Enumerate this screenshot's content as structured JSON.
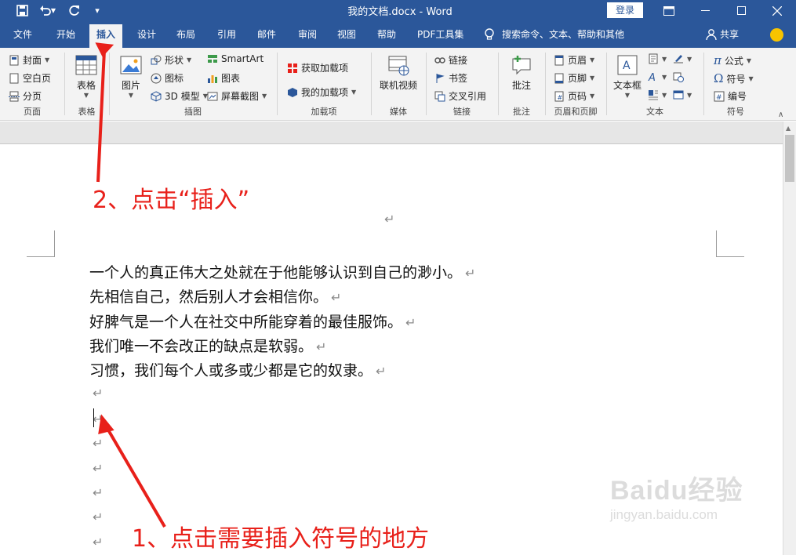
{
  "titlebar": {
    "title": "我的文档.docx - Word",
    "login": "登录"
  },
  "tabs": [
    "文件",
    "开始",
    "插入",
    "设计",
    "布局",
    "引用",
    "邮件",
    "审阅",
    "视图",
    "帮助",
    "PDF工具集"
  ],
  "search_text": "搜索命令、文本、帮助和其他",
  "share_label": "共享",
  "ribbon": {
    "pages": {
      "cover": "封面",
      "blank": "空白页",
      "break": "分页",
      "label": "页面"
    },
    "table": {
      "btn": "表格",
      "label": "表格"
    },
    "illus": {
      "picture": "图片",
      "shape": "形状",
      "icon": "图标",
      "model": "3D 模型",
      "smartart": "SmartArt",
      "chart": "图表",
      "screenshot": "屏幕截图",
      "label": "插图"
    },
    "addins": {
      "get": "获取加载项",
      "my": "我的加载项",
      "label": "加载项"
    },
    "media": {
      "video": "联机视频",
      "label": "媒体"
    },
    "links": {
      "link": "链接",
      "bookmark": "书签",
      "xref": "交叉引用",
      "label": "链接"
    },
    "comments": {
      "comment": "批注",
      "label": "批注"
    },
    "hf": {
      "header": "页眉",
      "footer": "页脚",
      "pagenum": "页码",
      "label": "页眉和页脚"
    },
    "text": {
      "textbox": "文本框",
      "label": "文本"
    },
    "symbols": {
      "equation": "公式",
      "symbol": "符号",
      "number": "编号",
      "label": "符号"
    }
  },
  "document": {
    "lines": [
      "一个人的真正伟大之处就在于他能够认识到自己的渺小。",
      "先相信自己，然后别人才会相信你。",
      "好脾气是一个人在社交中所能穿着的最佳服饰。",
      "我们唯一不会改正的缺点是软弱。",
      "习惯，我们每个人或多或少都是它的奴隶。"
    ],
    "para_mark": "↵"
  },
  "annotations": {
    "step2": "2、点击“插入”",
    "step1": "1、点击需要插入符号的地方"
  },
  "watermark": {
    "brand": "Baidu经验",
    "url": "jingyan.baidu.com"
  },
  "colors": {
    "title_bar": "#2b579a",
    "ribbon": "#f3f3f3",
    "annotation": "#e8201a"
  }
}
